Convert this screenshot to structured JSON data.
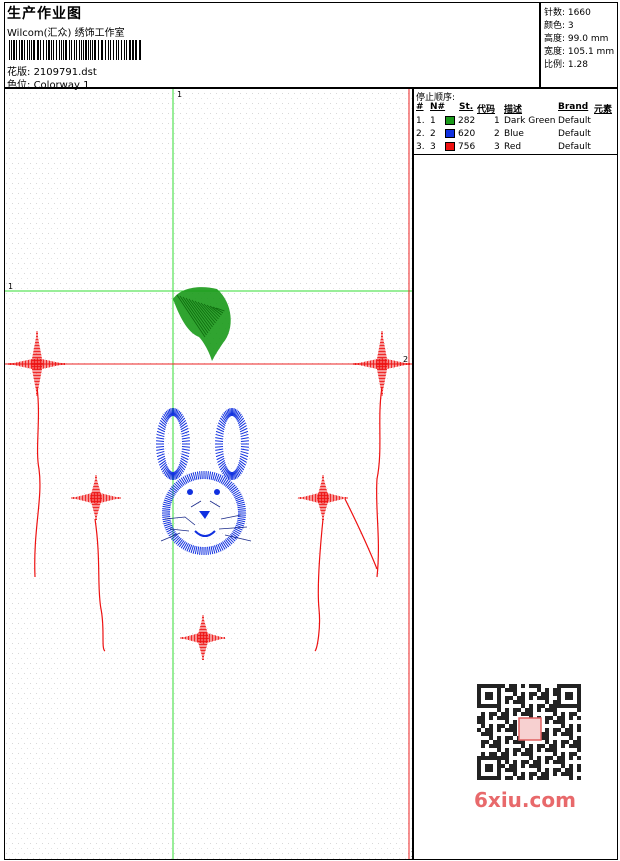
{
  "header": {
    "title": "生产作业图",
    "company": "Wilcom(汇众) 绣饰工作室",
    "file_label": "花版:",
    "file_name": "2109791.dst",
    "colorway_label": "色位:",
    "colorway": "Colorway 1"
  },
  "stats": [
    {
      "label": "针数:",
      "value": "1660"
    },
    {
      "label": "颜色:",
      "value": "3"
    },
    {
      "label": "高度:",
      "value": "99.0 mm"
    },
    {
      "label": "宽度:",
      "value": "105.1 mm"
    },
    {
      "label": "比例:",
      "value": "1.28"
    }
  ],
  "stop_sequence": {
    "title": "停止顺序:",
    "columns": [
      "#",
      "N#",
      "St.",
      "代码",
      "描述",
      "Brand",
      "元素"
    ],
    "rows": [
      {
        "index": "1.",
        "n": "1",
        "stitches": "282",
        "code": "1",
        "description": "Dark Green",
        "brand": "Default",
        "color": "#1a9a1a"
      },
      {
        "index": "2.",
        "n": "2",
        "stitches": "620",
        "code": "2",
        "description": "Blue",
        "brand": "Default",
        "color": "#1030e0"
      },
      {
        "index": "3.",
        "n": "3",
        "stitches": "756",
        "code": "3",
        "description": "Red",
        "brand": "Default",
        "color": "#ee1111"
      }
    ]
  },
  "canvas": {
    "marker_green_vertical": "1",
    "marker_green_horizontal": "1",
    "marker_red_horizontal": "2",
    "marker_red_vertical": "2"
  },
  "colors": {
    "green_guide": "#33dd33",
    "red_guide": "#ee2222",
    "dark_green": "#1a9a1a",
    "blue": "#1030e0",
    "red": "#ee1111",
    "watermark": "#e8696b"
  },
  "watermark": {
    "text": "6xiu.com",
    "icon": "qr-code-icon"
  }
}
